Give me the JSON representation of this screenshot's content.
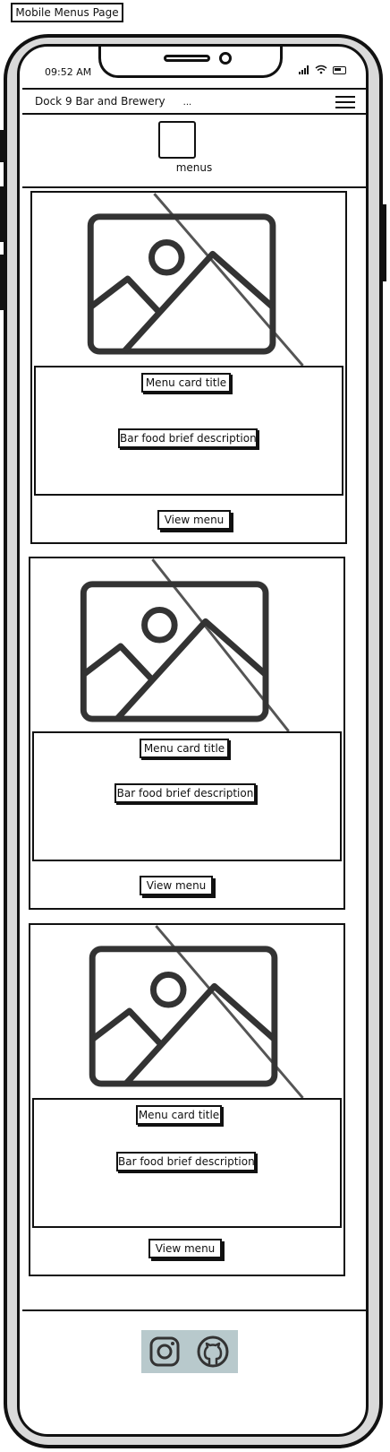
{
  "page_label": "Mobile Menus Page",
  "status_bar": {
    "time": "09:52 AM"
  },
  "navbar": {
    "brand": "Dock 9 Bar and Brewery",
    "brand_ellipsis": "..."
  },
  "logo": {
    "label": "menus"
  },
  "cards": [
    {
      "title": "Menu card title",
      "description": "Bar food brief description",
      "button": "View menu"
    },
    {
      "title": "Menu card title",
      "description": "Bar food brief description",
      "button": "View menu"
    },
    {
      "title": "Menu card title",
      "description": "Bar food brief description",
      "button": "View menu"
    }
  ],
  "footer": {
    "icons": [
      "instagram-icon",
      "github-icon"
    ]
  }
}
